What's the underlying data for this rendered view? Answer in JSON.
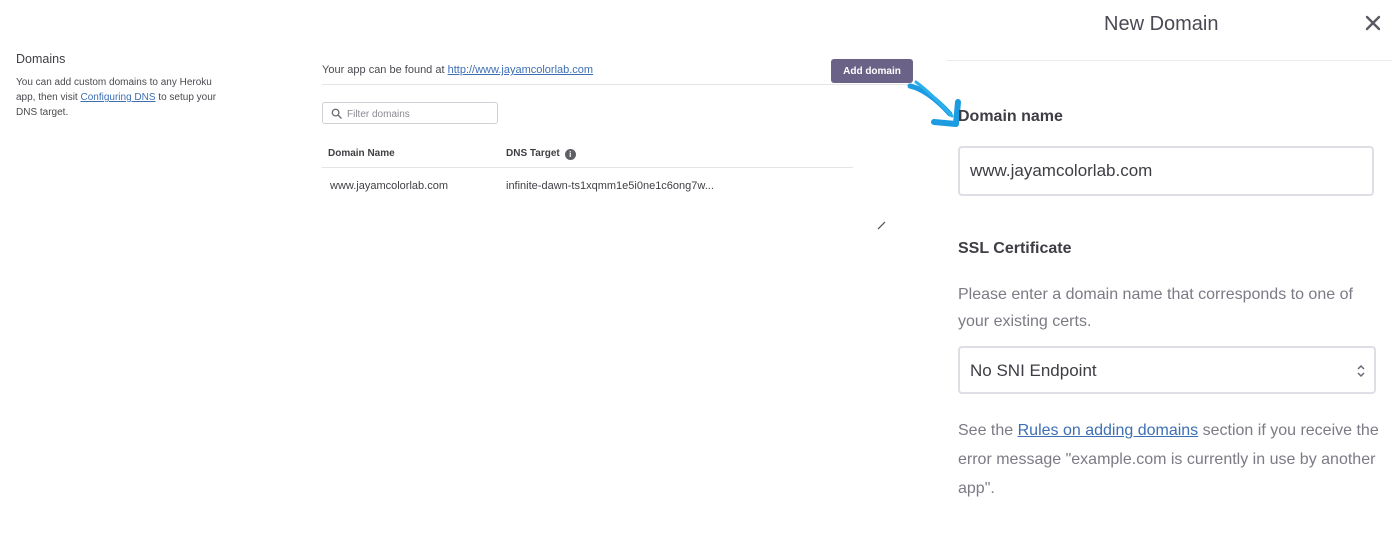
{
  "left": {
    "title": "Domains",
    "desc_before": "You can add custom domains to any Heroku app, then visit ",
    "desc_link": "Configuring DNS",
    "desc_after": " to setup your DNS target."
  },
  "main": {
    "found_prefix": "Your app can be found at ",
    "app_url": "http://www.jayamcolorlab.com",
    "add_button": "Add domain",
    "filter_placeholder": "Filter domains",
    "table": {
      "headers": [
        "Domain Name",
        "DNS Target"
      ],
      "rows": [
        {
          "domain": "www.jayamcolorlab.com",
          "dns_target": "infinite-dawn-ts1xqmm1e5i0ne1c6ong7w..."
        }
      ]
    }
  },
  "modal": {
    "title": "New Domain",
    "domain_label": "Domain name",
    "domain_value": "www.jayamcolorlab.com",
    "ssl_label": "SSL Certificate",
    "ssl_help": "Please enter a domain name that corresponds to one of your existing certs.",
    "ssl_select_value": "No SNI Endpoint",
    "rules_prefix": "See the ",
    "rules_link": "Rules on adding domains",
    "rules_suffix": " section if you receive the error message \"example.com is currently in use by another app\"."
  },
  "icons": {
    "close": "close-icon",
    "search": "search-icon",
    "info": "info-icon",
    "caret": "select-caret-icon",
    "arrow": "pointer-arrow-icon",
    "edit": "pencil-icon"
  },
  "colors": {
    "button": "#6b6387",
    "link": "#3d6fb4",
    "arrow": "#1d9be0"
  }
}
